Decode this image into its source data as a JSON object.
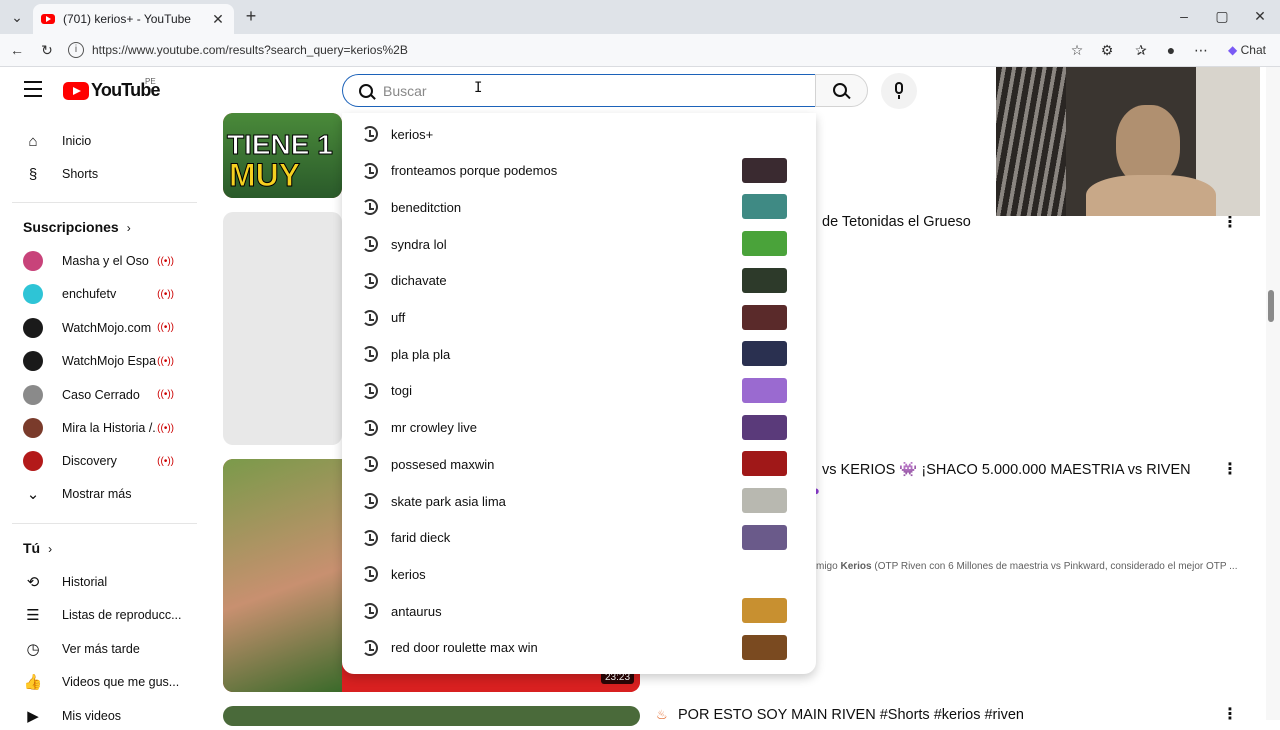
{
  "browser": {
    "tab_title": "(701) kerios+ - YouTube",
    "url": "https://www.youtube.com/results?search_query=kerios%2B",
    "chat_label": "Chat"
  },
  "header": {
    "logo_text": "YouTube",
    "country_code": "PE",
    "search_placeholder": "Buscar"
  },
  "sidebar": {
    "main": [
      {
        "label": "Inicio",
        "icon": "home-icon"
      },
      {
        "label": "Shorts",
        "icon": "shorts-icon"
      }
    ],
    "subscriptions_heading": "Suscripciones",
    "subscriptions": [
      {
        "label": "Masha y el Oso",
        "color": "#c8437a"
      },
      {
        "label": "enchufetv",
        "color": "#2ec4d6"
      },
      {
        "label": "WatchMojo.com",
        "color": "#1a1a1a"
      },
      {
        "label": "WatchMojo Espa...",
        "color": "#1a1a1a"
      },
      {
        "label": "Caso Cerrado",
        "color": "#8a8a8a"
      },
      {
        "label": "Mira la Historia /...",
        "color": "#7a3b2b"
      },
      {
        "label": "Discovery",
        "color": "#b31a1a"
      }
    ],
    "show_more": "Mostrar más",
    "you_heading": "Tú",
    "you_items": [
      {
        "label": "Historial",
        "icon": "history-icon"
      },
      {
        "label": "Listas de reproducc...",
        "icon": "playlists-icon"
      },
      {
        "label": "Ver más tarde",
        "icon": "watch-later-icon"
      },
      {
        "label": "Videos que me gus...",
        "icon": "like-icon"
      },
      {
        "label": "Mis videos",
        "icon": "my-videos-icon"
      }
    ]
  },
  "suggestions": [
    {
      "text": "kerios+",
      "thumb": null
    },
    {
      "text": "fronteamos porque podemos",
      "thumb": "#3a2a30"
    },
    {
      "text": "beneditction",
      "thumb": "#3f8a84"
    },
    {
      "text": "syndra lol",
      "thumb": "#4aa33a"
    },
    {
      "text": "dichavate",
      "thumb": "#2d3a2a"
    },
    {
      "text": "uff",
      "thumb": "#5a2a2a"
    },
    {
      "text": "pla pla pla",
      "thumb": "#2a3050"
    },
    {
      "text": "togi",
      "thumb": "#9a6ad0"
    },
    {
      "text": "mr crowley live",
      "thumb": "#5a3a7a"
    },
    {
      "text": "possesed maxwin",
      "thumb": "#a01818"
    },
    {
      "text": "skate park asia lima",
      "thumb": "#b8b8b0"
    },
    {
      "text": "farid dieck",
      "thumb": "#6a5a8a"
    },
    {
      "text": "kerios",
      "thumb": null
    },
    {
      "text": "antaurus",
      "thumb": "#c89030"
    },
    {
      "text": "red door roulette max win",
      "thumb": "#7a4a20"
    }
  ],
  "results": {
    "thumb1_text": [
      "TIENE 1",
      "MUY"
    ],
    "video2_title": "de Tetonidas el Grueso",
    "video3_title": "vs KERIOS 👾 ¡SHACO 5.000.000 MAESTRIA vs RIVEN",
    "video3_desc_prefix": "migo",
    "video3_desc_bold": "Kerios",
    "video3_desc_rest": "(OTP Riven con 6 Millones de maestria vs Pinkward, considerado el mejor OTP ...",
    "video3_duration": "23:23",
    "video4_title": "POR ESTO SOY MAIN RIVEN #Shorts #kerios #riven"
  }
}
